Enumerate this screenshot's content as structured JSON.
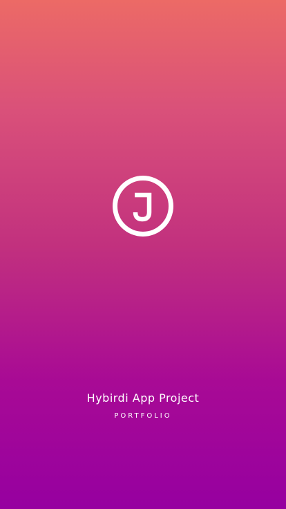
{
  "splash": {
    "logo_icon": "j-circle-logo-icon",
    "logo_letter": "J",
    "title": "Hybirdi App Project",
    "subtitle": "PORTFOLIO"
  },
  "colors": {
    "gradient_top": "#ec6a66",
    "gradient_bottom": "#9600a0",
    "foreground": "#ffffff"
  }
}
